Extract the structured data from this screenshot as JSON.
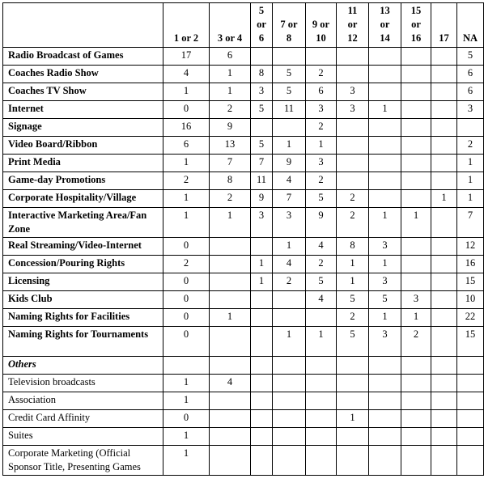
{
  "table": {
    "headers": [
      "",
      "1 or 2",
      "3 or 4",
      "5 or 6",
      "7 or 8",
      "9 or 10",
      "11 or 12",
      "13 or 14",
      "15 or 16",
      "17",
      "NA"
    ],
    "header_lines": [
      [
        ""
      ],
      [
        "1 or 2"
      ],
      [
        "3 or 4"
      ],
      [
        "5",
        "or",
        "6"
      ],
      [
        "7 or",
        "8"
      ],
      [
        "9 or",
        "10"
      ],
      [
        "11",
        "or",
        "12"
      ],
      [
        "13",
        "or",
        "14"
      ],
      [
        "15",
        "or",
        "16"
      ],
      [
        "17"
      ],
      [
        "NA"
      ]
    ],
    "rows": [
      {
        "label": "Radio Broadcast of Games",
        "style": "bold",
        "values": [
          "17",
          "6",
          "",
          "",
          "",
          "",
          "",
          "",
          "",
          "5"
        ]
      },
      {
        "label": "Coaches Radio Show",
        "style": "bold",
        "values": [
          "4",
          "1",
          "8",
          "5",
          "2",
          "",
          "",
          "",
          "",
          "6"
        ]
      },
      {
        "label": "Coaches TV Show",
        "style": "bold",
        "values": [
          "1",
          "1",
          "3",
          "5",
          "6",
          "3",
          "",
          "",
          "",
          "6"
        ]
      },
      {
        "label": "Internet",
        "style": "bold",
        "values": [
          "0",
          "2",
          "5",
          "11",
          "3",
          "3",
          "1",
          "",
          "",
          "3"
        ]
      },
      {
        "label": "Signage",
        "style": "bold",
        "values": [
          "16",
          "9",
          "",
          "",
          "2",
          "",
          "",
          "",
          "",
          ""
        ]
      },
      {
        "label": "Video Board/Ribbon",
        "style": "bold",
        "values": [
          "6",
          "13",
          "5",
          "1",
          "1",
          "",
          "",
          "",
          "",
          "2"
        ]
      },
      {
        "label": "Print Media",
        "style": "bold",
        "values": [
          "1",
          "7",
          "7",
          "9",
          "3",
          "",
          "",
          "",
          "",
          "1"
        ]
      },
      {
        "label": "Game-day Promotions",
        "style": "bold",
        "values": [
          "2",
          "8",
          "11",
          "4",
          "2",
          "",
          "",
          "",
          "",
          "1"
        ]
      },
      {
        "label": "Corporate Hospitality/Village",
        "style": "bold",
        "values": [
          "1",
          "2",
          "9",
          "7",
          "5",
          "2",
          "",
          "",
          "1",
          "1"
        ]
      },
      {
        "label": "Interactive Marketing Area/Fan Zone",
        "style": "bold",
        "tall": true,
        "values": [
          "1",
          "1",
          "3",
          "3",
          "9",
          "2",
          "1",
          "1",
          "",
          "7"
        ]
      },
      {
        "label": "Real Streaming/Video-Internet",
        "style": "bold",
        "values": [
          "0",
          "",
          "",
          "1",
          "4",
          "8",
          "3",
          "",
          "",
          "12"
        ]
      },
      {
        "label": "Concession/Pouring Rights",
        "style": "bold",
        "values": [
          "2",
          "",
          "1",
          "4",
          "2",
          "1",
          "1",
          "",
          "",
          "16"
        ]
      },
      {
        "label": "Licensing",
        "style": "bold",
        "values": [
          "0",
          "",
          "1",
          "2",
          "5",
          "1",
          "3",
          "",
          "",
          "15"
        ]
      },
      {
        "label": "Kids Club",
        "style": "bold",
        "values": [
          "0",
          "",
          "",
          "",
          "4",
          "5",
          "5",
          "3",
          "",
          "10"
        ]
      },
      {
        "label": "Naming Rights for Facilities",
        "style": "bold",
        "values": [
          "0",
          "1",
          "",
          "",
          "",
          "2",
          "1",
          "1",
          "",
          "22"
        ]
      },
      {
        "label": "Naming Rights for Tournaments",
        "style": "bold",
        "tall": true,
        "values": [
          "0",
          "",
          "",
          "1",
          "1",
          "5",
          "3",
          "2",
          "",
          "15"
        ]
      },
      {
        "label": "Others",
        "style": "bold-italic",
        "values": [
          "",
          "",
          "",
          "",
          "",
          "",
          "",
          "",
          "",
          ""
        ]
      },
      {
        "label": "Television broadcasts",
        "style": "normal",
        "values": [
          "1",
          "4",
          "",
          "",
          "",
          "",
          "",
          "",
          "",
          ""
        ]
      },
      {
        "label": "Association",
        "style": "normal",
        "values": [
          "1",
          "",
          "",
          "",
          "",
          "",
          "",
          "",
          "",
          ""
        ]
      },
      {
        "label": "Credit Card Affinity",
        "style": "normal",
        "values": [
          "0",
          "",
          "",
          "",
          "",
          "1",
          "",
          "",
          "",
          ""
        ]
      },
      {
        "label": "Suites",
        "style": "normal",
        "values": [
          "1",
          "",
          "",
          "",
          "",
          "",
          "",
          "",
          "",
          ""
        ]
      },
      {
        "label": "Corporate Marketing (Official Sponsor Title, Presenting Games",
        "style": "normal",
        "tall": true,
        "values": [
          "1",
          "",
          "",
          "",
          "",
          "",
          "",
          "",
          "",
          ""
        ]
      }
    ]
  }
}
